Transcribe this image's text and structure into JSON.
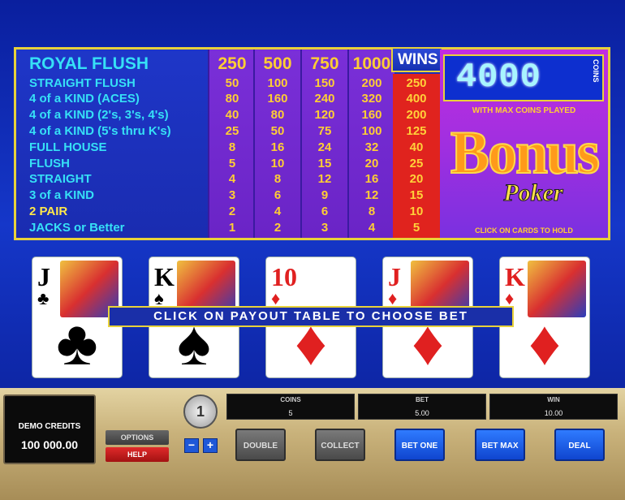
{
  "paytable": {
    "hands": [
      "ROYAL FLUSH",
      "STRAIGHT FLUSH",
      "4 of a KIND (ACES)",
      "4 of a KIND (2's, 3's, 4's)",
      "4 of a KIND (5's thru K's)",
      "FULL HOUSE",
      "FLUSH",
      "STRAIGHT",
      "3 of a KIND",
      "2 PAIR",
      "JACKS or Better"
    ],
    "columns": [
      [
        "250",
        "50",
        "80",
        "40",
        "25",
        "8",
        "5",
        "4",
        "3",
        "2",
        "1"
      ],
      [
        "500",
        "100",
        "160",
        "80",
        "50",
        "16",
        "10",
        "8",
        "6",
        "4",
        "2"
      ],
      [
        "750",
        "150",
        "240",
        "120",
        "75",
        "24",
        "15",
        "12",
        "9",
        "6",
        "3"
      ],
      [
        "1000",
        "200",
        "320",
        "160",
        "100",
        "32",
        "20",
        "16",
        "12",
        "8",
        "4"
      ]
    ],
    "wins_label": "WINS",
    "wins": [
      "250",
      "400",
      "200",
      "125",
      "40",
      "25",
      "20",
      "15",
      "10",
      "5"
    ]
  },
  "promo": {
    "coins": "4000",
    "coins_word": "COINS",
    "max_coins": "WITH MAX COINS PLAYED",
    "logo_bonus": "Bonus",
    "logo_poker": "Poker",
    "click_hold": "CLICK ON CARDS TO HOLD"
  },
  "cards": [
    {
      "rank": "J",
      "suit": "♣",
      "color": "black"
    },
    {
      "rank": "K",
      "suit": "♠",
      "color": "black"
    },
    {
      "rank": "10",
      "suit": "♦",
      "color": "red"
    },
    {
      "rank": "J",
      "suit": "♦",
      "color": "red"
    },
    {
      "rank": "K",
      "suit": "♦",
      "color": "red"
    }
  ],
  "banner": "CLICK ON PAYOUT TABLE TO CHOOSE BET",
  "panel": {
    "credits_label": "DEMO CREDITS",
    "credits_value": "100 000.00",
    "options": "OPTIONS",
    "help": "HELP",
    "coin_value": "1",
    "minus": "−",
    "plus": "+",
    "coins_label": "COINS",
    "coins_value": "5",
    "bet_label": "BET",
    "bet_value": "5.00",
    "win_label": "WIN",
    "win_value": "10.00",
    "double": "DOUBLE",
    "collect": "COLLECT",
    "bet_one": "BET ONE",
    "bet_max": "BET MAX",
    "deal": "DEAL"
  },
  "colors": {
    "hand_text": "#36e0f6",
    "value_text": "#ffce34",
    "wins_bg": "#e0231e",
    "frame": "#e8d23a"
  }
}
